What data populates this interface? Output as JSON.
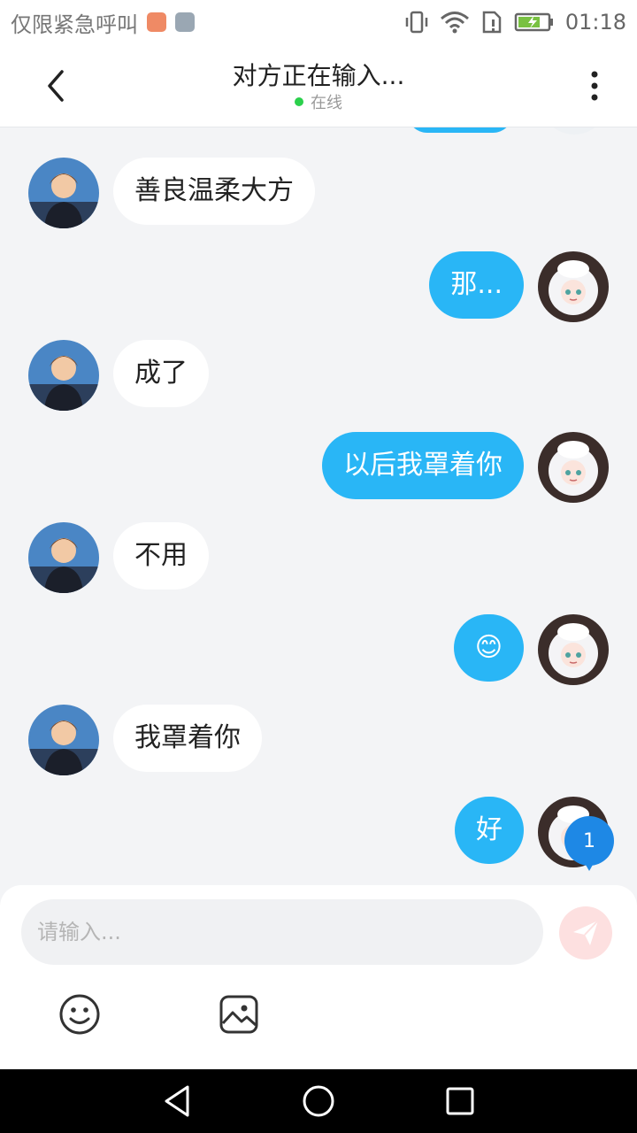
{
  "status_bar": {
    "carrier_text": "仅限紧急呼叫",
    "time": "01:18",
    "icons": [
      "mail-app-icon",
      "gallery-app-icon",
      "vibrate-icon",
      "wifi-icon",
      "sim-icon",
      "battery-charging-icon"
    ]
  },
  "header": {
    "title": "对方正在输入...",
    "status": "在线",
    "online_color": "#2bd04c"
  },
  "messages": [
    {
      "side": "left",
      "text": "善良温柔大方",
      "avatar": "boy-avatar"
    },
    {
      "side": "right",
      "text": "那...",
      "avatar": "girl-avatar"
    },
    {
      "side": "left",
      "text": "成了",
      "avatar": "boy-avatar"
    },
    {
      "side": "right",
      "text": "以后我罩着你",
      "avatar": "girl-avatar"
    },
    {
      "side": "left",
      "text": "不用",
      "avatar": "boy-avatar"
    },
    {
      "side": "right",
      "text": "😊",
      "avatar": "girl-avatar"
    },
    {
      "side": "left",
      "text": "我罩着你",
      "avatar": "boy-avatar"
    },
    {
      "side": "right",
      "text": "好",
      "avatar": "girl-avatar"
    }
  ],
  "unread_badge": "1",
  "composer": {
    "placeholder": "请输入...",
    "value": ""
  },
  "toolbar": [
    "emoji-icon",
    "image-icon"
  ],
  "colors": {
    "accent": "#29b6f6",
    "background": "#f3f4f6",
    "badge": "#1e88e5",
    "send_disabled": "#fde0e0"
  }
}
